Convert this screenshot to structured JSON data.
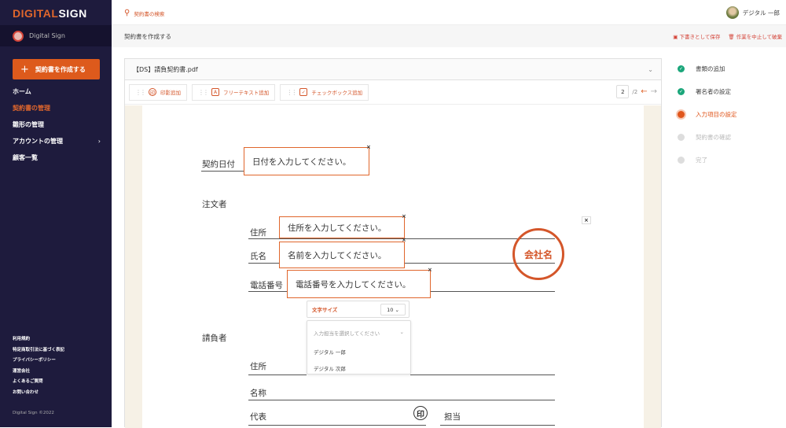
{
  "sidebar": {
    "logo_a": "DIGITAL",
    "logo_b": "SIGN",
    "org": "Digital Sign",
    "create": "契約書を作成する",
    "nav": [
      {
        "label": "ホーム"
      },
      {
        "label": "契約書の管理",
        "active": true
      },
      {
        "label": "雛形の管理"
      },
      {
        "label": "アカウントの管理"
      },
      {
        "label": "顧客一覧"
      }
    ],
    "footer": [
      "利用規約",
      "特定商取引法に基づく表記",
      "プライバシーポリシー",
      "運営会社",
      "よくあるご質問",
      "お問い合わせ"
    ],
    "copyright": "Digital Sign ©2022"
  },
  "topbar": {
    "search": "契約書の検索",
    "user": "デジタル 一郎"
  },
  "subheader": {
    "title": "契約書を作成する",
    "save": "下書きとして保存",
    "discard": "作業を中止して破棄"
  },
  "document": {
    "filename": "【DS】請負契約書.pdf",
    "tools": [
      {
        "label": "印影追加",
        "icon": "印"
      },
      {
        "label": "フリーテキスト追加",
        "icon": "A"
      },
      {
        "label": "チェックボックス追加",
        "icon": "✓"
      }
    ],
    "page": "2",
    "pages": "/2"
  },
  "form": {
    "date_label": "契約日付",
    "date_ph": "日付を入力してください。",
    "orderer": "注文者",
    "address": "住所",
    "address_ph": "住所を入力してください。",
    "name": "氏名",
    "name_ph": "名前を入力してください。",
    "phone": "電話番号",
    "phone_ph": "電話番号を入力してください。",
    "seal": "会社名",
    "contractor": "請負者",
    "c_address": "住所",
    "c_name": "名称",
    "c_rep": "代表",
    "inkan": "印",
    "c_charge": "担当"
  },
  "popup": {
    "font_size_label": "文字サイズ",
    "font_size": "10",
    "assignee_ph": "入力担当を選択してください",
    "options": [
      "デジタル 一郎",
      "デジタル 次郎"
    ]
  },
  "steps": [
    {
      "label": "書類の追加",
      "state": "done"
    },
    {
      "label": "署名者の設定",
      "state": "done"
    },
    {
      "label": "入力項目の設定",
      "state": "current"
    },
    {
      "label": "契約書の確認",
      "state": "todo"
    },
    {
      "label": "完了",
      "state": "todo"
    }
  ],
  "colors": {
    "accent": "#dd5a1c",
    "sidebar": "#1e1b3d",
    "done": "#1aa67a"
  }
}
